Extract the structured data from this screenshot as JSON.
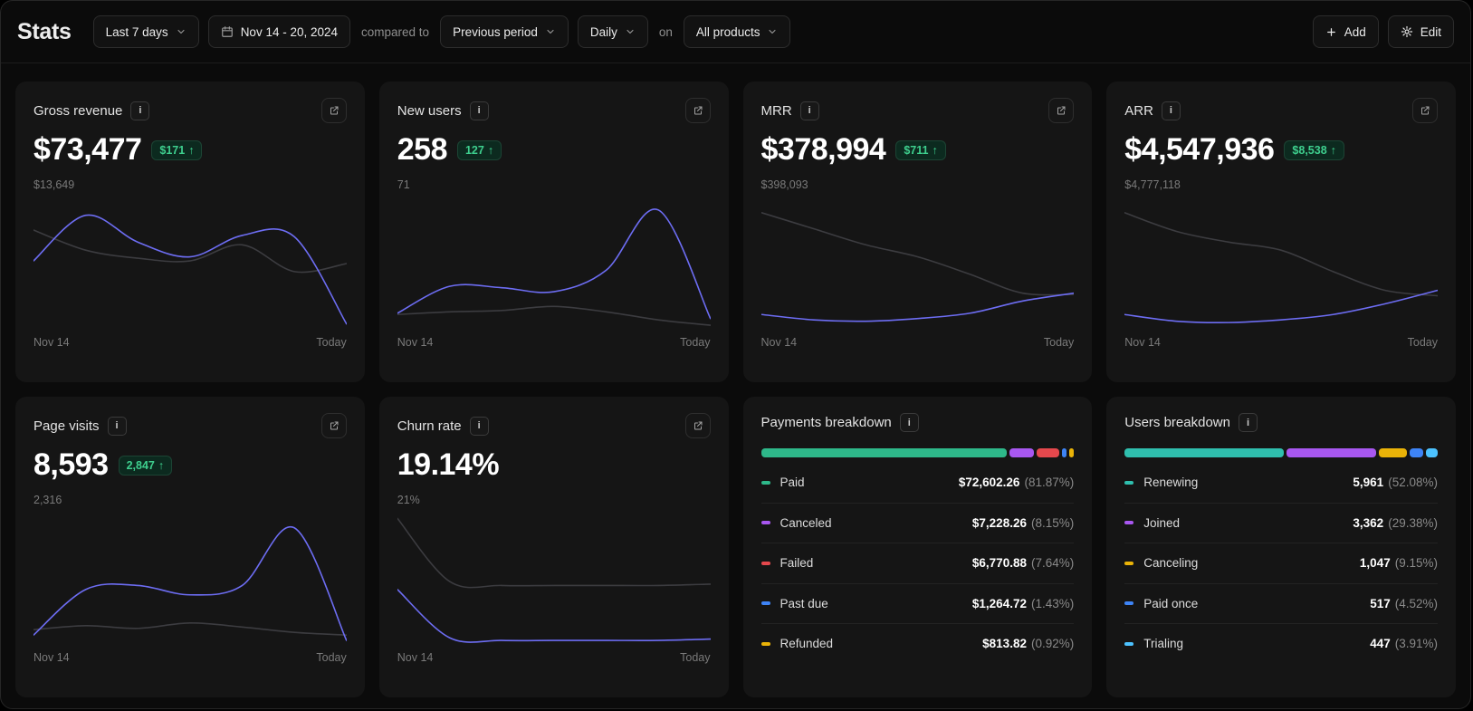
{
  "colors": {
    "accent_line": "#6d6df3",
    "previous_line": "#3c3c40",
    "positive_green": "#3ecf8e"
  },
  "icons": {
    "info": "i",
    "up_arrow": "↑"
  },
  "header": {
    "title": "Stats",
    "range_dropdown": "Last 7 days",
    "date_range": "Nov 14 - 20, 2024",
    "compared_to_label": "compared to",
    "compare_dropdown": "Previous period",
    "granularity_dropdown": "Daily",
    "on_label": "on",
    "products_dropdown": "All products",
    "add_button": "Add",
    "edit_button": "Edit"
  },
  "cards": [
    {
      "title": "Gross revenue",
      "value": "$73,477",
      "delta": "$171",
      "ref_label": "$13,649",
      "x_start": "Nov 14",
      "x_end": "Today"
    },
    {
      "title": "New users",
      "value": "258",
      "delta": "127",
      "ref_label": "71",
      "x_start": "Nov 14",
      "x_end": "Today"
    },
    {
      "title": "MRR",
      "value": "$378,994",
      "delta": "$711",
      "ref_label": "$398,093",
      "x_start": "Nov 14",
      "x_end": "Today"
    },
    {
      "title": "ARR",
      "value": "$4,547,936",
      "delta": "$8,538",
      "ref_label": "$4,777,118",
      "x_start": "Nov 14",
      "x_end": "Today"
    },
    {
      "title": "Page visits",
      "value": "8,593",
      "delta": "2,847",
      "ref_label": "2,316",
      "x_start": "Nov 14",
      "x_end": "Today"
    },
    {
      "title": "Churn rate",
      "value": "19.14%",
      "delta": "",
      "ref_label": "21%",
      "x_start": "Nov 14",
      "x_end": "Today"
    }
  ],
  "chart_data": [
    {
      "type": "line",
      "title": "Gross revenue",
      "x": [
        "Nov 14",
        "Today"
      ],
      "ylim": [
        0,
        100
      ],
      "series": [
        {
          "name": "previous period",
          "color": "#3c3c40",
          "values": [
            75,
            60,
            54,
            52,
            64,
            44,
            50
          ]
        },
        {
          "name": "current",
          "color": "#6d6df3",
          "values": [
            52,
            86,
            66,
            55,
            71,
            70,
            5
          ]
        }
      ]
    },
    {
      "type": "line",
      "title": "New users",
      "x": [
        "Nov 14",
        "Today"
      ],
      "ylim": [
        0,
        100
      ],
      "series": [
        {
          "name": "previous period",
          "color": "#3c3c40",
          "values": [
            12,
            14,
            15,
            18,
            14,
            8,
            4
          ]
        },
        {
          "name": "current",
          "color": "#6d6df3",
          "values": [
            13,
            33,
            32,
            29,
            45,
            90,
            9
          ]
        }
      ]
    },
    {
      "type": "line",
      "title": "MRR",
      "x": [
        "Nov 14",
        "Today"
      ],
      "ylim": [
        0,
        100
      ],
      "series": [
        {
          "name": "previous period",
          "color": "#3c3c40",
          "values": [
            88,
            76,
            64,
            55,
            42,
            28,
            27
          ]
        },
        {
          "name": "current",
          "color": "#6d6df3",
          "values": [
            12,
            8,
            7,
            9,
            13,
            22,
            28
          ]
        }
      ]
    },
    {
      "type": "line",
      "title": "ARR",
      "x": [
        "Nov 14",
        "Today"
      ],
      "ylim": [
        0,
        100
      ],
      "series": [
        {
          "name": "previous period",
          "color": "#3c3c40",
          "values": [
            88,
            74,
            66,
            60,
            44,
            30,
            26
          ]
        },
        {
          "name": "current",
          "color": "#6d6df3",
          "values": [
            12,
            7,
            6,
            8,
            12,
            20,
            30
          ]
        }
      ]
    },
    {
      "type": "line",
      "title": "Page visits",
      "x": [
        "Nov 14",
        "Today"
      ],
      "ylim": [
        0,
        100
      ],
      "series": [
        {
          "name": "previous period",
          "color": "#3c3c40",
          "values": [
            12,
            15,
            13,
            17,
            14,
            10,
            8
          ]
        },
        {
          "name": "current",
          "color": "#6d6df3",
          "values": [
            8,
            42,
            45,
            38,
            45,
            88,
            4
          ]
        }
      ]
    },
    {
      "type": "line",
      "title": "Churn rate",
      "x": [
        "Nov 14",
        "Today"
      ],
      "ylim": [
        0,
        100
      ],
      "series": [
        {
          "name": "previous period",
          "color": "#3c3c40",
          "values": [
            95,
            48,
            45,
            45,
            45,
            45,
            46
          ]
        },
        {
          "name": "current",
          "color": "#6d6df3",
          "values": [
            42,
            6,
            4,
            4,
            4,
            4,
            5
          ]
        }
      ]
    },
    {
      "type": "stacked_bar",
      "title": "Payments breakdown",
      "rows": [
        {
          "label": "Paid",
          "color": "#2eb88a",
          "amount": "$72,602.26",
          "pct": "81.87%"
        },
        {
          "label": "Canceled",
          "color": "#a857f0",
          "amount": "$7,228.26",
          "pct": "8.15%"
        },
        {
          "label": "Failed",
          "color": "#e5484d",
          "amount": "$6,770.88",
          "pct": "7.64%"
        },
        {
          "label": "Past due",
          "color": "#3e84f6",
          "amount": "$1,264.72",
          "pct": "1.43%"
        },
        {
          "label": "Refunded",
          "color": "#eab308",
          "amount": "$813.82",
          "pct": "0.92%"
        }
      ]
    },
    {
      "type": "stacked_bar",
      "title": "Users breakdown",
      "rows": [
        {
          "label": "Renewing",
          "color": "#2fbfae",
          "amount": "5,961",
          "pct": "52.08%"
        },
        {
          "label": "Joined",
          "color": "#a857f0",
          "amount": "3,362",
          "pct": "29.38%"
        },
        {
          "label": "Canceling",
          "color": "#eab308",
          "amount": "1,047",
          "pct": "9.15%"
        },
        {
          "label": "Paid once",
          "color": "#3e84f6",
          "amount": "517",
          "pct": "4.52%"
        },
        {
          "label": "Trialing",
          "color": "#4cc2ff",
          "amount": "447",
          "pct": "3.91%"
        }
      ]
    }
  ]
}
